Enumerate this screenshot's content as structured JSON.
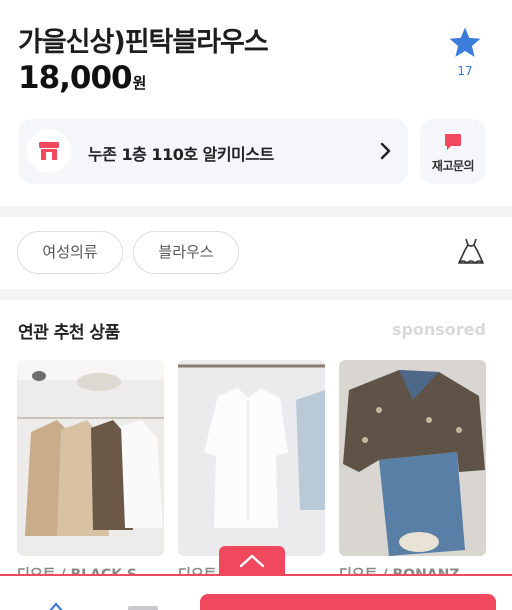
{
  "product": {
    "title": "가을신상)핀탁블라우스",
    "price": "18,000",
    "price_unit": "원",
    "favorite_count": "17",
    "favorite_icon": "star-icon"
  },
  "store": {
    "name": "누존 1층 110호 알키미스트",
    "icon": "store-icon"
  },
  "inquiry": {
    "label": "재고문의",
    "icon": "chat-bubble-icon"
  },
  "tags": [
    {
      "label": "여성의류"
    },
    {
      "label": "블라우스"
    }
  ],
  "related": {
    "title": "연관 추천 상품",
    "sponsored_label": "sponsored",
    "items": [
      {
        "caption": "디오트 / BLACK S"
      },
      {
        "caption": "디오트 / ...IT"
      },
      {
        "caption": "디오트 / BONANZ"
      }
    ]
  },
  "colors": {
    "accent_pink": "#f1485e",
    "favorite_blue": "#3a7ddb",
    "card_bg": "#f4f6fa"
  }
}
